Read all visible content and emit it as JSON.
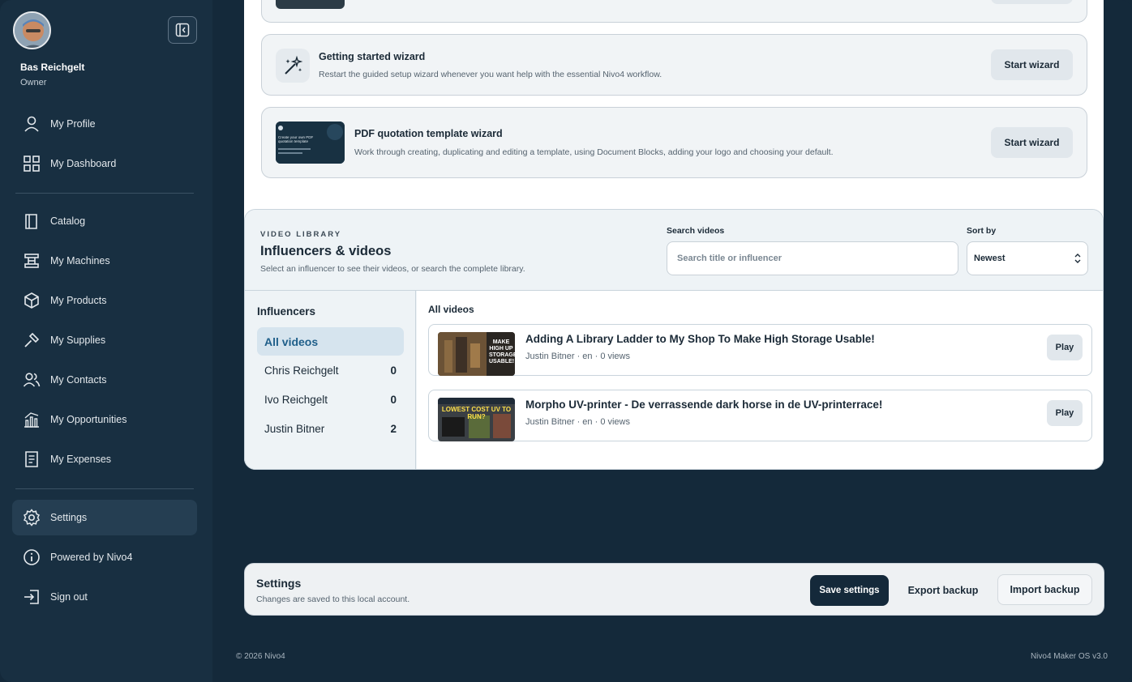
{
  "user": {
    "name": "Bas Reichgelt",
    "role": "Owner"
  },
  "sidebar": {
    "items": [
      {
        "label": "My Profile",
        "icon": "user-icon"
      },
      {
        "label": "My Dashboard",
        "icon": "dashboard-icon"
      },
      {
        "label": "Catalog",
        "icon": "book-icon"
      },
      {
        "label": "My Machines",
        "icon": "machine-icon"
      },
      {
        "label": "My Products",
        "icon": "box-icon"
      },
      {
        "label": "My Supplies",
        "icon": "hammer-icon"
      },
      {
        "label": "My Contacts",
        "icon": "contacts-icon"
      },
      {
        "label": "My Opportunities",
        "icon": "chart-icon"
      },
      {
        "label": "My Expenses",
        "icon": "receipt-icon"
      },
      {
        "label": "Settings",
        "icon": "gear-icon",
        "active": true
      },
      {
        "label": "Powered by Nivo4",
        "icon": "info-icon"
      },
      {
        "label": "Sign out",
        "icon": "sign-out-icon"
      }
    ]
  },
  "wizards": {
    "getting_started": {
      "title": "Getting started wizard",
      "description": "Restart the guided setup wizard whenever you want help with the essential Nivo4 workflow.",
      "button": "Start wizard"
    },
    "pdf_template": {
      "title": "PDF quotation template wizard",
      "description": "Work through creating, duplicating and editing a template, using Document Blocks, adding your logo and choosing your default.",
      "button": "Start wizard",
      "thumb_text": "Create your own PDF quotation template"
    }
  },
  "video_library": {
    "kicker": "VIDEO LIBRARY",
    "title": "Influencers & videos",
    "subtitle": "Select an influencer to see their videos, or search the complete library.",
    "search_label": "Search videos",
    "search_placeholder": "Search title or influencer",
    "sort_label": "Sort by",
    "sort_value": "Newest",
    "influencers_heading": "Influencers",
    "influencers": [
      {
        "name": "All videos",
        "count": null,
        "active": true
      },
      {
        "name": "Chris Reichgelt",
        "count": "0"
      },
      {
        "name": "Ivo Reichgelt",
        "count": "0"
      },
      {
        "name": "Justin Bitner",
        "count": "2"
      }
    ],
    "videos_heading": "All videos",
    "videos": [
      {
        "title": "Adding A Library Ladder to My Shop To Make High Storage Usable!",
        "meta": "Justin Bitner · en · 0 views",
        "play": "Play",
        "thumb_text": "MAKE HIGH UP STORAGE USABLE!"
      },
      {
        "title": "Morpho UV-printer - De verrassende dark horse in de UV-printerrace!",
        "meta": "Justin Bitner · en · 0 views",
        "play": "Play",
        "thumb_text": "LOWEST COST UV TO RUN?"
      }
    ]
  },
  "settings_bar": {
    "title": "Settings",
    "subtitle": "Changes are saved to this local account.",
    "save": "Save settings",
    "export": "Export backup",
    "import": "Import backup"
  },
  "footer": {
    "copyright": "© 2026 Nivo4",
    "version": "Nivo4 Maker OS v3.0"
  },
  "colors": {
    "sidebar_bg": "#182f41",
    "page_bg": "#14293a",
    "accent": "#1f5f8a"
  }
}
